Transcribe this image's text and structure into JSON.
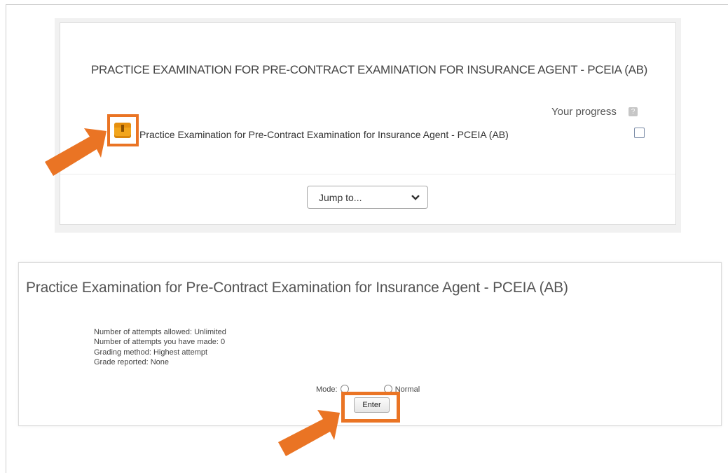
{
  "course": {
    "title": "PRACTICE EXAMINATION FOR PRE-CONTRACT EXAMINATION FOR INSURANCE AGENT - PCEIA (AB)",
    "progress_label": "Your progress",
    "progress_help_icon": "?",
    "activity_icon": "quiz-icon",
    "activity_name": "Practice Examination for Pre-Contract Examination for Insurance Agent - PCEIA (AB)",
    "activity_completed": false,
    "jump_to": "Jump to..."
  },
  "quiz": {
    "title": "Practice Examination for Pre-Contract Examination for Insurance Agent - PCEIA (AB)",
    "info": [
      "Number of attempts allowed: Unlimited",
      "Number of attempts you have made: 0",
      "Grading method: Highest attempt",
      "Grade reported: None"
    ],
    "mode_label": "Mode:",
    "mode_option_normal": "Normal",
    "enter_label": "Enter"
  },
  "colors": {
    "highlight": "#ea7424",
    "quiz_icon": "#f2a51c"
  }
}
